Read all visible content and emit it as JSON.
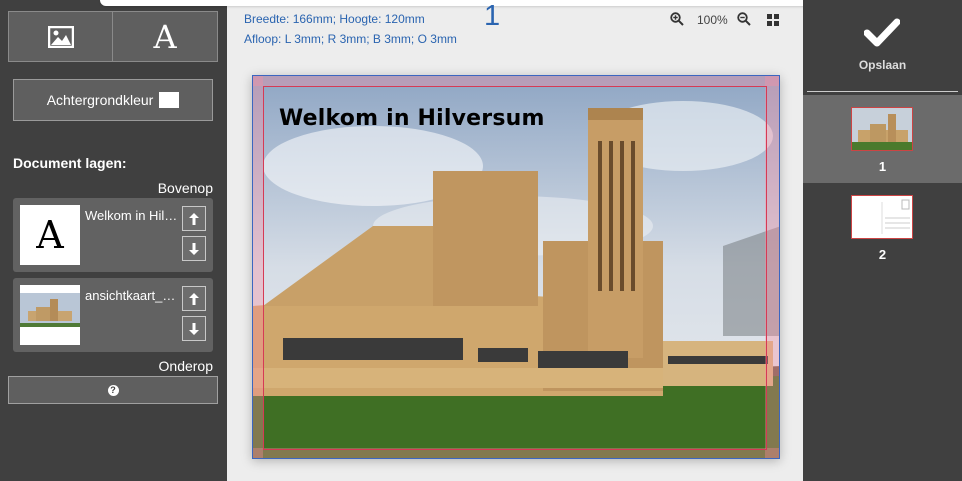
{
  "left_panel": {
    "tools": [
      {
        "name": "image",
        "icon": "image-icon"
      },
      {
        "name": "text",
        "glyph": "A",
        "icon": "text-a-icon"
      }
    ],
    "background_button": {
      "label": "Achtergrondkleur",
      "swatch_color": "#ffffff"
    },
    "layers": {
      "title": "Document lagen:",
      "top_label": "Bovenop",
      "bottom_label": "Onderop",
      "items": [
        {
          "name": "Welkom in Hilversum",
          "type": "text",
          "thumb_glyph": "A"
        },
        {
          "name": "ansichtkaart_hilversum",
          "type": "image"
        }
      ]
    },
    "help_icon": "question-icon"
  },
  "editor": {
    "dimensions": "Breedte: 166mm; Hoogte: 120mm",
    "bleed": "Afloop: L 3mm; R 3mm; B 3mm; O 3mm",
    "page_number": "1",
    "zoom": "100%",
    "headline": "Welkom in Hilversum"
  },
  "right_panel": {
    "save_label": "Opslaan",
    "pages": [
      {
        "number": "1",
        "selected": true
      },
      {
        "number": "2",
        "selected": false
      }
    ]
  },
  "colors": {
    "panel_bg": "#404040",
    "accent_blue": "#2a64b0",
    "trim_line": "#d63a55",
    "selected_page_bg": "#6b6b6b"
  }
}
